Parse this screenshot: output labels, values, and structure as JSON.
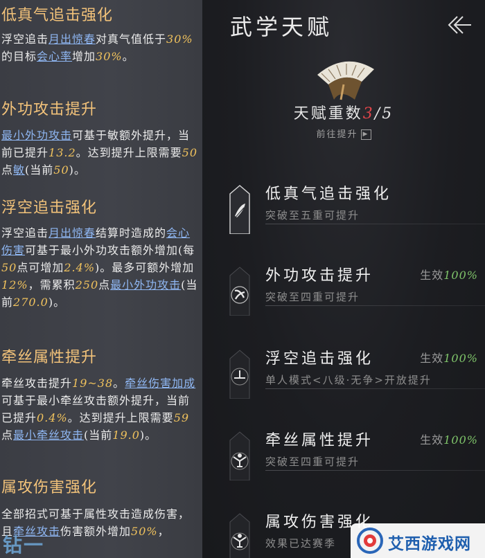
{
  "left_panel": {
    "sections": [
      {
        "title": "低真气追击强化",
        "text": [
          {
            "t": "浮空追击"
          },
          {
            "t": "月出惊春",
            "k": "link"
          },
          {
            "t": "对真气值低于"
          },
          {
            "t": "30%",
            "k": "hl"
          },
          {
            "t": "的目标"
          },
          {
            "t": "会心率",
            "k": "link"
          },
          {
            "t": "增加"
          },
          {
            "t": "30%",
            "k": "hl"
          },
          {
            "t": "。"
          }
        ]
      },
      {
        "title": "外功攻击提升",
        "text": [
          {
            "t": "最小外功攻击",
            "k": "link"
          },
          {
            "t": "可基于敏额外提升，当前已提升"
          },
          {
            "t": "13.2",
            "k": "hl"
          },
          {
            "t": "。达到提升上限需要"
          },
          {
            "t": "50",
            "k": "hl"
          },
          {
            "t": "点"
          },
          {
            "t": "敏",
            "k": "link"
          },
          {
            "t": "(当前"
          },
          {
            "t": "50",
            "k": "hl"
          },
          {
            "t": ")。"
          }
        ]
      },
      {
        "title": "浮空追击强化",
        "text": [
          {
            "t": "浮空追击"
          },
          {
            "t": "月出惊春",
            "k": "link"
          },
          {
            "t": "结算时造成的"
          },
          {
            "t": "会心伤害",
            "k": "link"
          },
          {
            "t": "可基于最小外功攻击额外增加(每"
          },
          {
            "t": "50",
            "k": "hl"
          },
          {
            "t": "点可增加"
          },
          {
            "t": "2.4%",
            "k": "hl"
          },
          {
            "t": ")。最多可额外增加"
          },
          {
            "t": "12%",
            "k": "hl"
          },
          {
            "t": "，需累积"
          },
          {
            "t": "250",
            "k": "hl"
          },
          {
            "t": "点"
          },
          {
            "t": "最小外功攻击",
            "k": "link"
          },
          {
            "t": "(当前"
          },
          {
            "t": "270.0",
            "k": "hl"
          },
          {
            "t": ")。"
          }
        ]
      },
      {
        "title": "牵丝属性提升",
        "text": [
          {
            "t": "牵丝攻击提升"
          },
          {
            "t": "19~38",
            "k": "hl"
          },
          {
            "t": "。"
          },
          {
            "t": "牵丝伤害加成",
            "k": "link"
          },
          {
            "t": "可基于最小牵丝攻击额外提升，当前已提升"
          },
          {
            "t": "0.4%",
            "k": "hl"
          },
          {
            "t": "。达到提升上限需要"
          },
          {
            "t": "59",
            "k": "hl"
          },
          {
            "t": "点"
          },
          {
            "t": "最小牵丝攻击",
            "k": "link"
          },
          {
            "t": "(当前"
          },
          {
            "t": "19.0",
            "k": "hl"
          },
          {
            "t": ")。"
          }
        ]
      },
      {
        "title": "属攻伤害强化",
        "text": [
          {
            "t": "全部招式可基于属性攻击造成伤害，且"
          },
          {
            "t": "牵丝攻击",
            "k": "link"
          },
          {
            "t": "伤害额外增加"
          },
          {
            "t": "50%",
            "k": "hl"
          },
          {
            "t": "，"
          }
        ]
      }
    ]
  },
  "right_panel": {
    "title": "武学天赋",
    "back_icon": "double-chevron-left-icon",
    "weight_label": "天赋重数",
    "weight_current": "3",
    "weight_sep_max": "/5",
    "goto_label": "前往提升",
    "talents": [
      {
        "name": "低真气追击强化",
        "status_label": "",
        "status_pct": "",
        "condition": "突破至五重可提升",
        "icon": "feather-icon"
      },
      {
        "name": "外功攻击提升",
        "status_label": "生效",
        "status_pct": "100%",
        "condition": "突破至四重可提升",
        "icon": "swirl-icon"
      },
      {
        "name": "浮空追击强化",
        "status_label": "生效",
        "status_pct": "100%",
        "condition": "单人模式<八级·无争>开放提升",
        "icon": "plus-spark-icon"
      },
      {
        "name": "牵丝属性提升",
        "status_label": "生效",
        "status_pct": "100%",
        "condition": "突破至四重可提升",
        "icon": "puppet-icon"
      },
      {
        "name": "属攻伤害强化",
        "status_label": "",
        "status_pct": "",
        "condition": "效果已达赛季",
        "icon": "puppet-icon"
      }
    ]
  },
  "watermarks": {
    "left": "钻一玩",
    "right": "艾西游戏网"
  },
  "colors": {
    "highlight": "#f0c25d",
    "link": "#8fb7f3",
    "section_title": "#f3c37a",
    "weight_current": "#e0454a",
    "effective_pct": "#7fc46a"
  }
}
